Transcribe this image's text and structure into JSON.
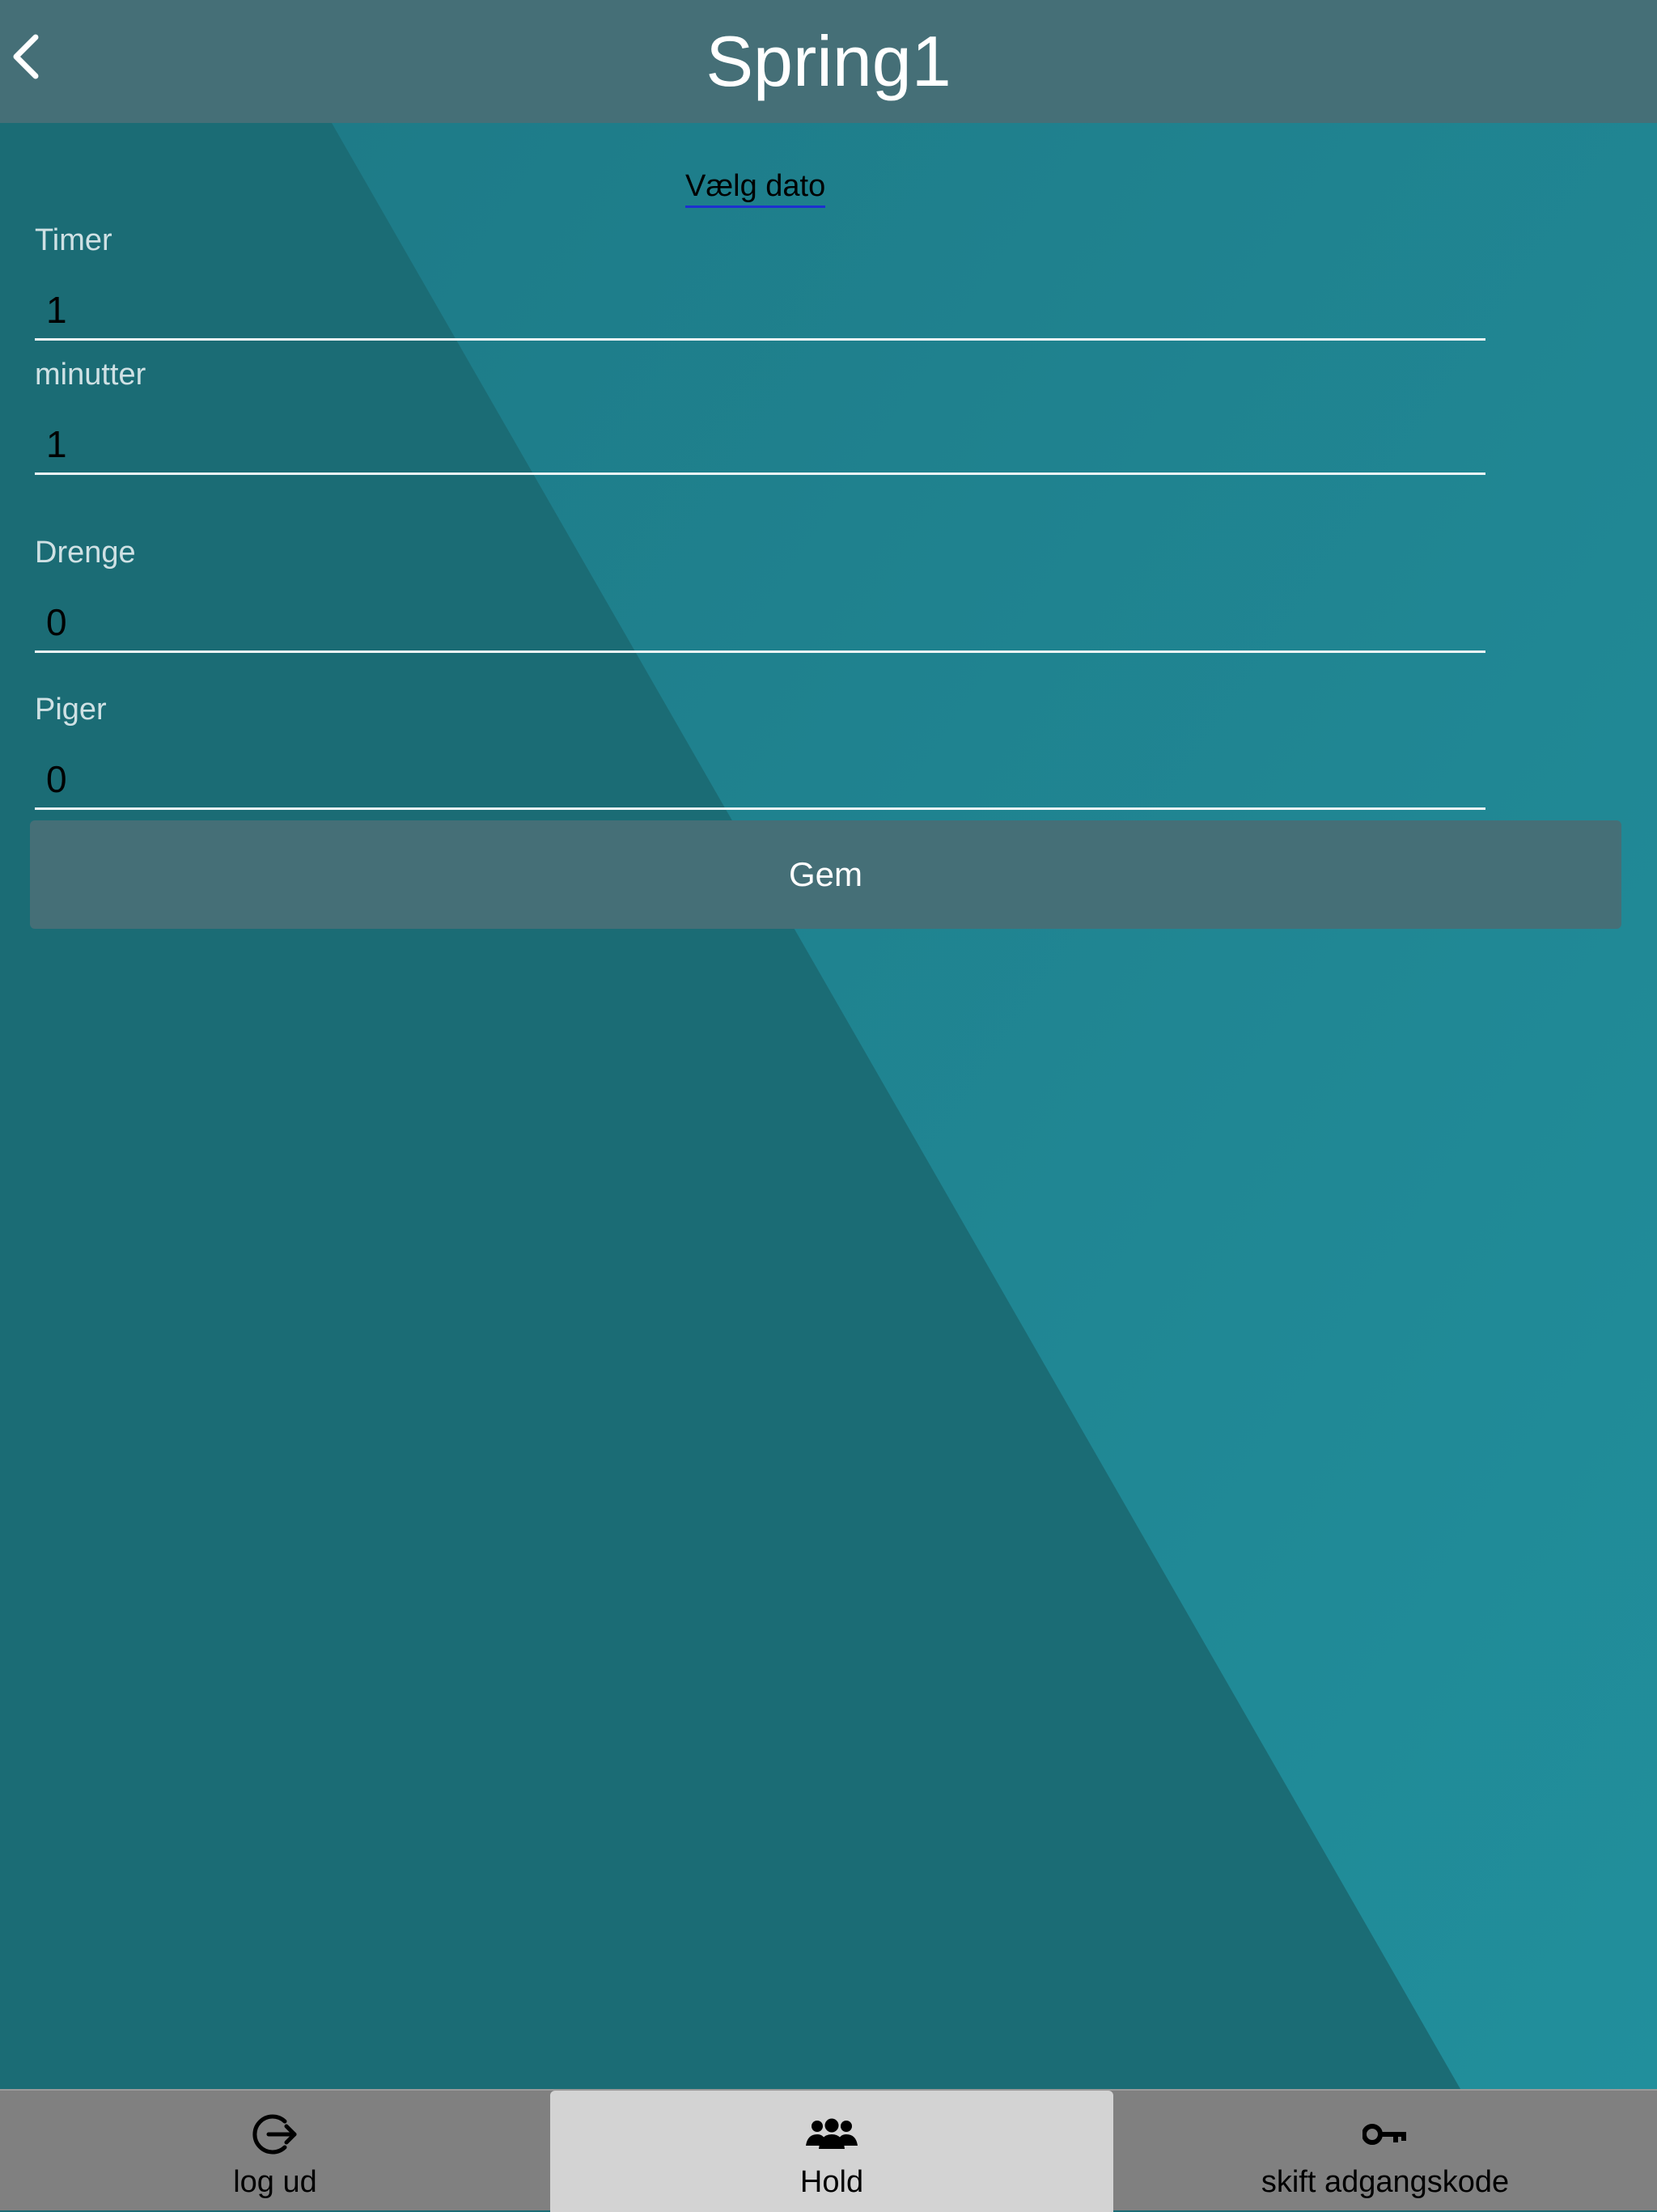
{
  "header": {
    "title": "Spring1",
    "back_icon": "chevron-left-icon"
  },
  "form": {
    "date_link": "Vælg dato",
    "fields": [
      {
        "label": "Timer",
        "value": "1"
      },
      {
        "label": "minutter",
        "value": "1"
      },
      {
        "label": "Drenge",
        "value": "0"
      },
      {
        "label": "Piger",
        "value": "0"
      }
    ],
    "save_label": "Gem"
  },
  "tabbar": {
    "tabs": [
      {
        "label": "log ud",
        "icon": "logout-icon",
        "active": false
      },
      {
        "label": "Hold",
        "icon": "team-icon",
        "active": true
      },
      {
        "label": "skift adgangskode",
        "icon": "key-icon",
        "active": false
      }
    ]
  },
  "colors": {
    "header": "#456f77",
    "background_dark": "#1b6c75",
    "background_light": "#1f8594",
    "tabbar": "#808080",
    "tab_active": "#d3d3d3"
  }
}
